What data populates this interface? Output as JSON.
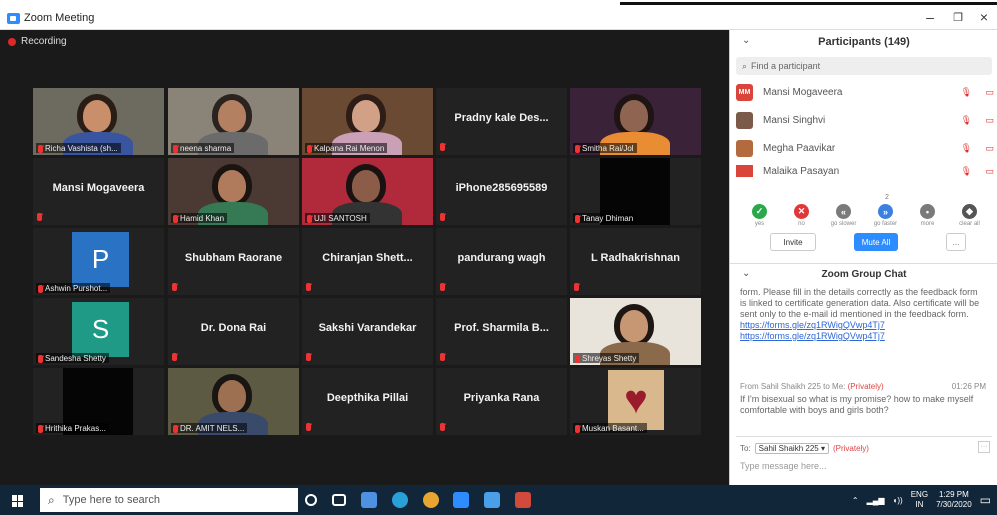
{
  "window": {
    "title": "Zoom Meeting"
  },
  "recording": "Recording",
  "tiles": [
    {
      "label": "Richa Vashista (sh...",
      "kind": "photo",
      "bg": "#6d6a60",
      "skin": "#c98e6a",
      "hair": "#2a1d16",
      "shirt": "#3a55a0",
      "active": true
    },
    {
      "label": "neena sharma",
      "kind": "photo",
      "bg": "#8a8478",
      "skin": "#b48062",
      "hair": "#2b2320",
      "shirt": "#6b6b6b"
    },
    {
      "label": "Kalpana Rai Menon",
      "kind": "photo",
      "bg": "#6b4a33",
      "skin": "#d1a086",
      "hair": "#2e1d17",
      "shirt": "#caa0b6"
    },
    {
      "center": "Pradny kale Des...",
      "kind": "text"
    },
    {
      "label": "Smitha Rai/Jol",
      "kind": "photo",
      "bg": "#3a2238",
      "skin": "#8f6450",
      "hair": "#1f1414",
      "shirt": "#e98d35"
    },
    {
      "center": "Mansi Mogaveera",
      "kind": "text"
    },
    {
      "label": "Hamid Khan",
      "kind": "photo",
      "bg": "#4a3a33",
      "skin": "#b07a5c",
      "hair": "#1b1512",
      "shirt": "#357a55"
    },
    {
      "label": "UJI SANTOSH",
      "kind": "photo",
      "bg": "#b02a3c",
      "skin": "#8b5d48",
      "hair": "#1a1212",
      "shirt": "#333333"
    },
    {
      "center": "iPhone285695589",
      "kind": "text"
    },
    {
      "label": "Tanay Dhiman",
      "kind": "black"
    },
    {
      "label": "Ashwin Purshot...",
      "kind": "avatar",
      "letter": "P",
      "color": "#2a72c4"
    },
    {
      "center": "Shubham Raorane",
      "kind": "text"
    },
    {
      "center": "Chiranjan  Shett...",
      "kind": "text"
    },
    {
      "center": "pandurang wagh",
      "kind": "text"
    },
    {
      "center": "L Radhakrishnan",
      "kind": "text"
    },
    {
      "label": "Sandesha Shetty",
      "kind": "avatar",
      "letter": "S",
      "color": "#1e9a86"
    },
    {
      "center": "Dr. Dona Rai",
      "kind": "text"
    },
    {
      "center": "Sakshi Varandekar",
      "kind": "text"
    },
    {
      "center": "Prof. Sharmila B...",
      "kind": "text"
    },
    {
      "label": "Shreyas Shetty",
      "kind": "photo",
      "bg": "#e8e4dc",
      "skin": "#c79673",
      "hair": "#1e1613",
      "shirt": "#8a6a4a"
    },
    {
      "label": "Hrithika Prakas...",
      "kind": "black"
    },
    {
      "label": "DR. AMIT NELS...",
      "kind": "photo",
      "bg": "#5d5a44",
      "skin": "#9d7052",
      "hair": "#191512",
      "shirt": "#3a4a6a"
    },
    {
      "center": "Deepthika Pillai",
      "kind": "text"
    },
    {
      "center": "Priyanka Rana",
      "kind": "text"
    },
    {
      "label": "Muskan Basant...",
      "kind": "heart"
    }
  ],
  "participants": {
    "title": "Participants (149)",
    "search_placeholder": "Find a participant",
    "list": [
      {
        "initials": "MM",
        "name": "Mansi Mogaveera",
        "color": "#d9453a"
      },
      {
        "initials": "",
        "name": "Mansi Singhvi",
        "color": "#7b5a4a"
      },
      {
        "initials": "",
        "name": "Megha Paavikar",
        "color": "#b26a3e"
      },
      {
        "initials": "",
        "name": "Malaika Pasayan",
        "color": "#d9453a"
      }
    ],
    "reaction_count": "2",
    "reactions": [
      {
        "label": "yes",
        "color": "#2aa84a",
        "glyph": "✓"
      },
      {
        "label": "no",
        "color": "#e03838",
        "glyph": "✕"
      },
      {
        "label": "go slower",
        "color": "#7a7a7a",
        "glyph": "«"
      },
      {
        "label": "go faster",
        "color": "#3b7fe0",
        "glyph": "»"
      },
      {
        "label": "more",
        "color": "#7a7a7a",
        "glyph": "•"
      },
      {
        "label": "clear all",
        "color": "#555555",
        "glyph": "◆"
      }
    ],
    "invite": "Invite",
    "mute_all": "Mute All",
    "more": "..."
  },
  "chat": {
    "title": "Zoom Group Chat",
    "body": "form. Please fill in the details correctly as the feedback form is linked to certificate generation data. Also certificate will be sent only to the e-mail id mentioned in the feedback form.",
    "link1": "https://forms.gle/zq1RWigQVwp4Tj7",
    "link2": "https://forms.gle/zq1RWigQVwp4Tj7",
    "from": "From Sahil Shaikh 225 to Me:",
    "from_private": "(Privately)",
    "time": "01:26 PM",
    "message": "If I'm bisexual so what is my promise? how to make myself comfortable with boys and girls both?",
    "to_label": "To:",
    "to_value": "Sahil Shaikh 225 ▾",
    "to_private": "(Privately)",
    "input_placeholder": "Type message here..."
  },
  "taskbar": {
    "search": "Type here to search",
    "lang1": "ENG",
    "lang2": "IN",
    "time": "1:29 PM",
    "date": "7/30/2020"
  }
}
